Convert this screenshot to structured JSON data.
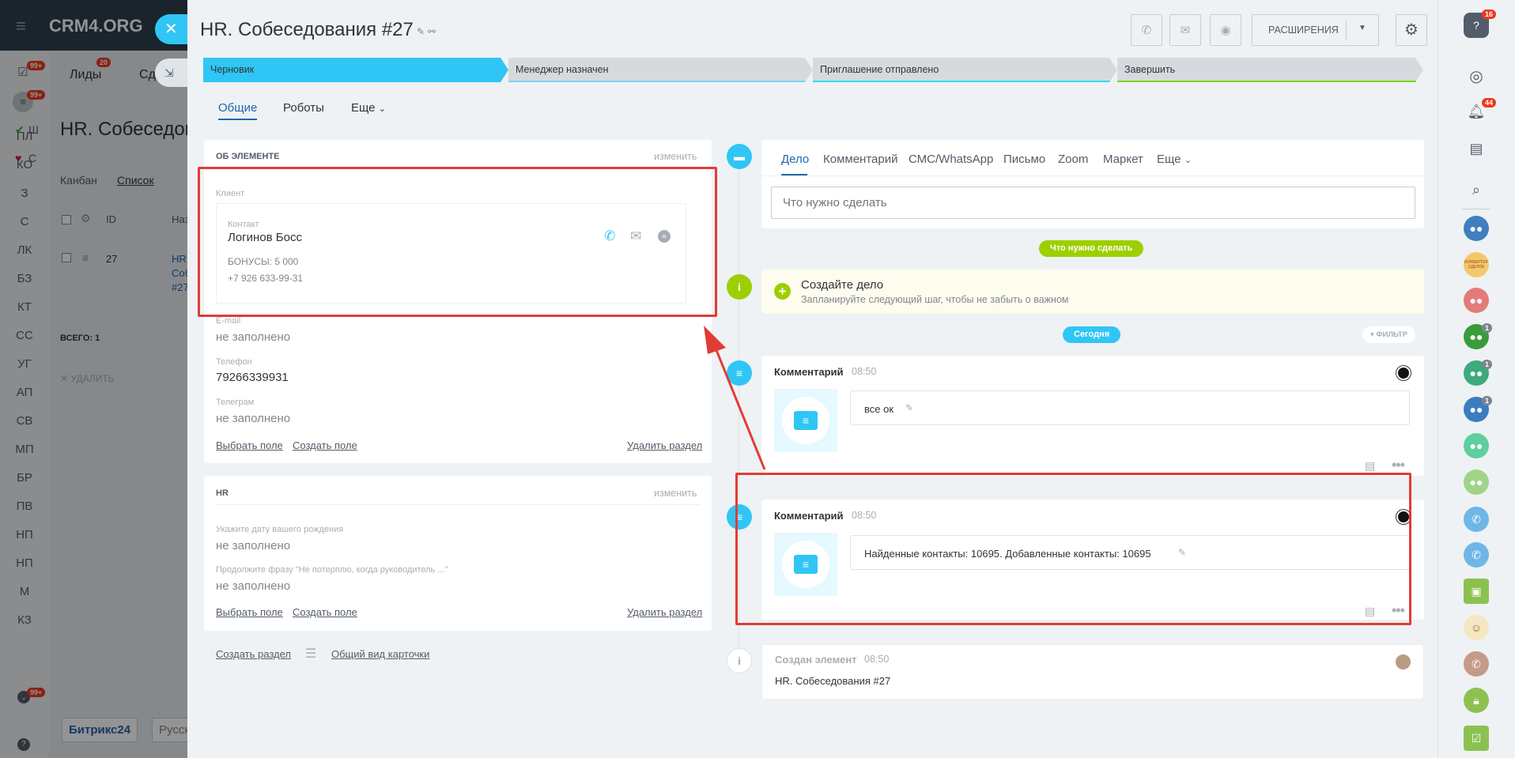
{
  "bg": {
    "logo": "CRM4.ORG",
    "tab_leads": "Лиды",
    "tab_leads_badge": "20",
    "tab_deals": "Сд",
    "badge_99a": "99+",
    "badge_99b": "99+",
    "badge_99c": "99+",
    "left_menu": [
      "Ш",
      "С",
      "ПЛ",
      "КО",
      "З",
      "С",
      "ЛК",
      "БЗ",
      "КТ",
      "СС",
      "УГ",
      "АП",
      "СВ",
      "МП",
      "БР",
      "ПВ",
      "НП",
      "НП",
      "М",
      "КЗ"
    ],
    "page_title": "HR. Собеседов",
    "view_kanban": "Канбан",
    "view_list": "Список",
    "col_id": "ID",
    "col_name": "Наз",
    "row_id": "27",
    "row_name_1": "HR.",
    "row_name_2": "Соб",
    "row_name_3": "#27",
    "total": "ВСЕГО: 1",
    "delete": "УДАЛИТЬ",
    "footer_brand": "Битрикс24",
    "footer_lang": "Русск"
  },
  "slider": {
    "close_icon": "close-icon",
    "title": "HR. Собеседования #27",
    "extensions_label": "РАСШИРЕНИЯ",
    "stages": [
      "Черновик",
      "Менеджер назначен",
      "Приглашение отправлено",
      "Завершить"
    ],
    "stage_colors": [
      "#2fc6f6",
      "#7bd2f6",
      "#2fdbe8",
      "#7bd500"
    ],
    "tabs": [
      "Общие",
      "Роботы",
      "Еще"
    ]
  },
  "about": {
    "header": "ОБ ЭЛЕМЕНТЕ",
    "edit": "изменить",
    "client_label": "Клиент",
    "contact_label": "Контакт",
    "contact_name": "Логинов Босс",
    "bonus": "БОНУСЫ: 5 000",
    "phone": "+7 926 633-99-31",
    "email_label": "E-mail",
    "email_value": "не заполнено",
    "phone_label": "Телефон",
    "phone_value": "79266339931",
    "telegram_label": "Телеграм",
    "telegram_value": "не заполнено",
    "select_field": "Выбрать поле",
    "create_field": "Создать поле",
    "delete_section": "Удалить раздел"
  },
  "hr": {
    "header": "HR",
    "edit": "изменить",
    "birth_label": "Укажите дату вашего рождения",
    "birth_value": "не заполнено",
    "phrase_label": "Продолжите фразу \"Не потерплю, когда руководитель ...\"",
    "phrase_value": "не заполнено",
    "select_field": "Выбрать поле",
    "create_field": "Создать поле",
    "delete_section": "Удалить раздел"
  },
  "bottom_links": {
    "create_section": "Создать раздел",
    "common_view": "Общий вид карточки"
  },
  "timeline": {
    "tabs": [
      "Дело",
      "Комментарий",
      "СМС/WhatsApp",
      "Письмо",
      "Zoom",
      "Маркет",
      "Еще"
    ],
    "input_placeholder": "Что нужно сделать",
    "todo_badge": "Что нужно сделать",
    "create_title": "Создайте дело",
    "create_sub": "Запланируйте следующий шаг, чтобы не забыть о важном",
    "today_badge": "Сегодня",
    "filter": "ФИЛЬТР",
    "comment1_title": "Комментарий",
    "comment1_time": "08:50",
    "comment1_text": "все ок",
    "comment2_title": "Комментарий",
    "comment2_time": "08:50",
    "comment2_text": "Найденные контакты: 10695. Добавленные контакты: 10695",
    "created_title": "Создан элемент",
    "created_time": "08:50",
    "created_text": "HR. Собеседования #27"
  },
  "right": {
    "badge_help": "16",
    "badge_bell": "44",
    "badge_g1": "1",
    "badge_g2": "1",
    "badge_g3": "1",
    "consult_text": "КОНВЕРТЕР СДЕЛОК"
  },
  "colors": {
    "accent": "#2fc6f6",
    "green": "#7bd500",
    "red_box": "#e23b35",
    "link_blue": "#2067b0"
  }
}
